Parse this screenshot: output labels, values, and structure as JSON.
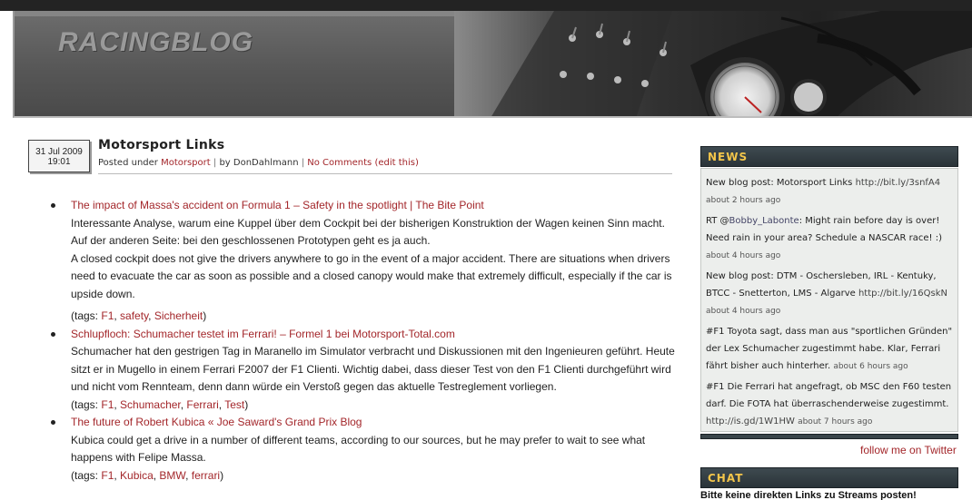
{
  "site": {
    "title": "RACINGBLOG"
  },
  "post": {
    "date": "31 Jul 2009",
    "time": "19:01",
    "title": "Motorsport Links",
    "posted_under": "Posted under",
    "category": "Motorsport",
    "sep1": "|",
    "by": "by DonDahlmann",
    "sep2": "|",
    "comments": "No Comments (edit this)"
  },
  "links": [
    {
      "title": "The impact of Massa's accident on Formula 1 – Safety in the spotlight | The Bite Point",
      "text1": "Interessante Analyse, warum eine Kuppel über dem Cockpit bei der bisherigen Konstruktion der Wagen keinen Sinn macht. Auf der anderen Seite: bei den geschlossenen Prototypen geht es ja auch.",
      "text2": "A closed cockpit does not give the drivers anywhere to go in the event of a major accident. There are situations when drivers need to evacuate the car as soon as possible and a closed canopy would make that extremely difficult, especially if the car is upside down.",
      "tags_label": "(tags:",
      "tags": [
        "F1",
        "safety",
        "Sicherheit"
      ],
      "tags_end": ")"
    },
    {
      "title": "Schlupfloch: Schumacher testet im Ferrari! – Formel 1 bei Motorsport-Total.com",
      "text1": "Schumacher hat den gestrigen Tag in Maranello im Simulator verbracht und Diskussionen mit den Ingenieuren geführt. Heute sitzt er in Mugello in einem Ferrari F2007 der F1 Clienti. Wichtig dabei, dass dieser Test von den F1 Clienti durchgeführt wird und nicht vom Rennteam, denn dann würde ein Verstoß gegen das aktuelle Testreglement vorliegen.",
      "tags_label": "(tags:",
      "tags": [
        "F1",
        "Schumacher",
        "Ferrari",
        "Test"
      ],
      "tags_end": ")"
    },
    {
      "title": "The future of Robert Kubica « Joe Saward's Grand Prix Blog",
      "text1": "Kubica could get a drive in a number of different teams, according to our sources, but he may prefer to wait to see what happens with Felipe Massa.",
      "tags_label": "(tags:",
      "tags": [
        "F1",
        "Kubica",
        "BMW",
        "ferrari"
      ],
      "tags_end": ")"
    }
  ],
  "sidebar": {
    "news_title": "NEWS",
    "tweets": [
      {
        "text": "New blog post: Motorsport Links",
        "link": "http://bit.ly/3snfA4",
        "time": "about 2 hours ago"
      },
      {
        "prefix": "RT @",
        "mention": "Bobby_Labonte",
        "text": ": Might rain before day is over! Need rain in your area? Schedule a NASCAR race! :)",
        "time": "about 4 hours ago"
      },
      {
        "text": "New blog post: DTM - Oschersleben, IRL - Kentuky, BTCC - Snetterton, LMS - Algarve",
        "link": "http://bit.ly/16QskN",
        "time": "about 4 hours ago"
      },
      {
        "text": "#F1 Toyota sagt, dass man aus \"sportlichen Gründen\" der Lex Schumacher zugestimmt habe. Klar, Ferrari fährt bisher auch hinterher.",
        "time": "about 6 hours ago"
      },
      {
        "text": "#F1 Die Ferrari hat angefragt, ob MSC den F60 testen darf. Die FOTA hat überraschenderweise zugestimmt.",
        "link": "http://is.gd/1W1HW",
        "time": "about 7 hours ago"
      }
    ],
    "follow": "follow me on Twitter",
    "chat_title": "CHAT",
    "chat_text": "Bitte keine direkten Links zu Streams posten!"
  },
  "colors": {
    "link": "#a3262a",
    "widget_title": "#f3c54a",
    "widget_bg": "#2a3338"
  }
}
